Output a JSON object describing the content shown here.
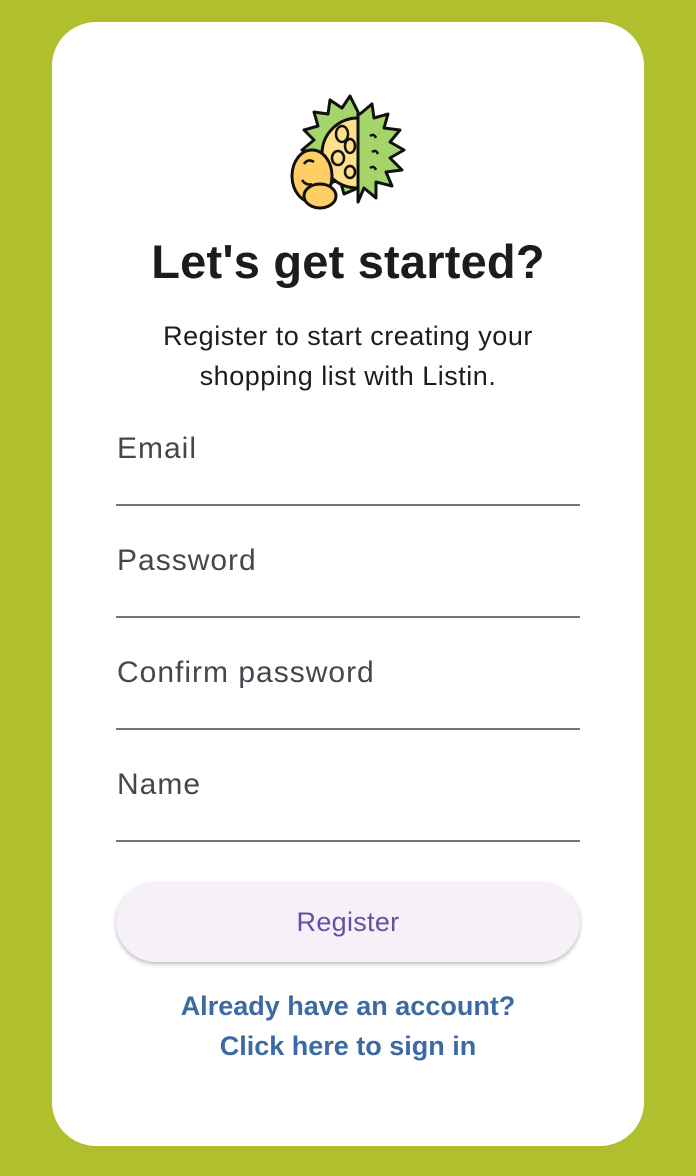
{
  "colors": {
    "background": "#afbf2e",
    "card": "#ffffff",
    "title": "#1d1b20",
    "field_label": "#49454f",
    "field_underline": "#757575",
    "button_bg": "#f6f1f8",
    "button_text": "#6750a4",
    "link": "#3c6aa3"
  },
  "logo": {
    "icon": "durian-fruit-icon"
  },
  "header": {
    "title": "Let's get started?",
    "subtitle": "Register to start creating your shopping list with Listin."
  },
  "form": {
    "email": {
      "label": "Email",
      "value": ""
    },
    "password": {
      "label": "Password",
      "value": ""
    },
    "confirm_password": {
      "label": "Confirm password",
      "value": ""
    },
    "name": {
      "label": "Name",
      "value": ""
    }
  },
  "actions": {
    "register_label": "Register",
    "signin_line1": "Already have an account?",
    "signin_line2": "Click here to sign in"
  }
}
